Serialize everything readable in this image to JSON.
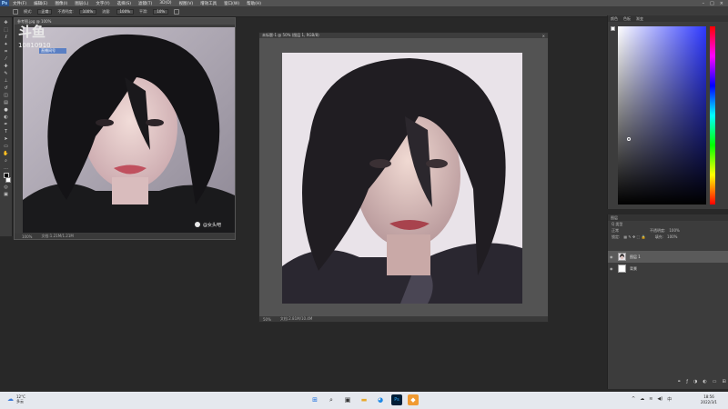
{
  "menubar": {
    "logo": "Ps",
    "items": [
      "文件(F)",
      "编辑(E)",
      "图像(I)",
      "图层(L)",
      "文字(Y)",
      "选择(S)",
      "滤镜(T)",
      "3D(D)",
      "视图(V)",
      "增效工具",
      "窗口(W)",
      "帮助(H)"
    ]
  },
  "optionsbar": {
    "mode_label": "正常",
    "opacity_label": "不透明度:",
    "opacity_value": "100%",
    "flow_label": "流量:",
    "flow_value": "100%",
    "smooth_label": "平滑:",
    "smooth_value": "10%"
  },
  "watermark": {
    "logo": "斗鱼",
    "ribbon": "直播间号",
    "room": "10810910"
  },
  "doc_left": {
    "tab": "参考图.jpg @ 100%",
    "zoom": "100%",
    "info": "文档:1.21M/1.21M",
    "credit": "@女头吧"
  },
  "doc_right": {
    "tab": "未标题-1 @ 50% (图层 1, RGB/8)",
    "zoom": "50%",
    "info": "文档:2.81M/10.4M"
  },
  "color_panel": {
    "tabs": [
      "颜色",
      "色板",
      "渐变"
    ]
  },
  "layers_panel": {
    "tab": "图层",
    "kind": "Q 类型",
    "mode": "正常",
    "opacity_label": "不透明度:",
    "opacity_value": "100%",
    "lock_label": "锁定:",
    "fill_label": "填充:",
    "fill_value": "100%",
    "layers": [
      {
        "name": "图层 1",
        "active": true
      },
      {
        "name": "背景",
        "active": false
      }
    ]
  },
  "taskbar": {
    "weather_temp": "12°C",
    "weather_desc": "多云",
    "time": "18:56",
    "date": "2022/3/1"
  },
  "colors": {
    "app_bg": "#282828",
    "panel_bg": "#3c3c3c",
    "accent": "#2e38ff"
  }
}
